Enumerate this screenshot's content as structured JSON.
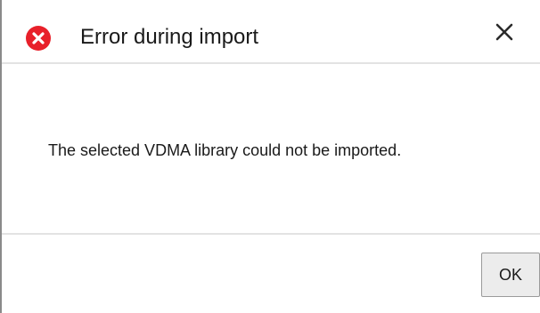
{
  "dialog": {
    "title": "Error during import",
    "title_icon": "error-icon",
    "close_icon": "close-icon",
    "message": "The selected VDMA library could not be imported.",
    "ok_label": "OK"
  },
  "colors": {
    "error_red": "#e8202a",
    "divider": "#e3e3e3",
    "button_bg": "#ececec"
  }
}
